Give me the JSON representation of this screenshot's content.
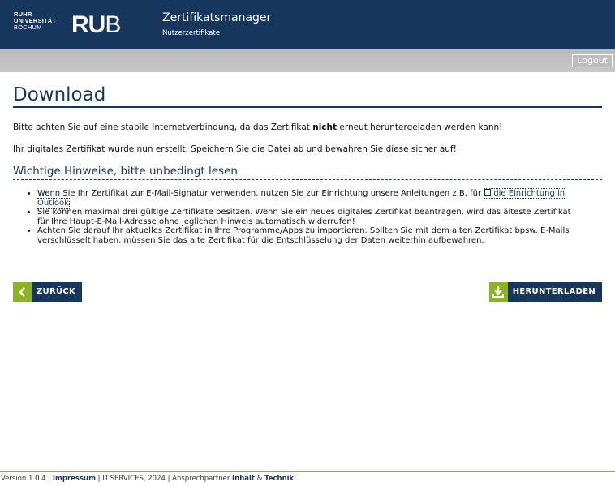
{
  "header": {
    "logo_line1": "RUHR",
    "logo_line2": "UNIVERSITÄT",
    "logo_line3": "BOCHUM",
    "logo_mark_bold": "RU",
    "logo_mark_light": "B",
    "app_title": "Zertifikatsmanager",
    "app_subtitle": "Nutzerzertifikate",
    "background_color": "#17365d"
  },
  "toolbar": {
    "logout_label": "Logout"
  },
  "main": {
    "title": "Download",
    "para1_pre": "Bitte achten Sie auf eine stabile Internetverbindung, da das Zertifikat ",
    "para1_bold": "nicht",
    "para1_post": " erneut heruntergeladen werden kann!",
    "para2": "Ihr digitales Zertifikat wurde nun erstellt. Speichern Sie die Datei ab und bewahren Sie diese sicher auf!",
    "hints_heading": "Wichtige Hinweise, bitte unbedingt lesen",
    "hint1_pre": "Wenn Sie Ihr Zertifikat zur E-Mail-Signatur verwenden, nutzen Sie zur Einrichtung unsere Anleitungen z.B. für ",
    "hint1_link": "die Einrichtung in Outlook",
    "hint2": "Sie können maximal drei gültige Zertifikate besitzen. Wenn Sie ein neues digitales Zertifikat beantragen, wird das älteste Zertifikat für Ihre Haupt-E-Mail-Adresse ohne jeglichen Hinweis automatisch widerrufen!",
    "hint3": "Achten Sie darauf Ihr aktuelles Zertifikat in Ihre Programme/Apps zu importieren. Sollten Sie mit dem alten Zertifikat bpsw. E-Mails verschlüsselt haben, müssen Sie das alte Zertifikat für die Entschlüsselung der Daten weiterhin aufbewahren.",
    "back_label": "ZURÜCK",
    "download_label": "HERUNTERLADEN",
    "accent_color": "#8ab424"
  },
  "footer": {
    "version": "Version 1.0.4 | ",
    "impressum": "Impressum",
    "middle": " | IT.SERVICES, 2024 | Ansprechpartner ",
    "inhalt": "Inhalt",
    "amp": " & ",
    "technik": "Technik"
  }
}
